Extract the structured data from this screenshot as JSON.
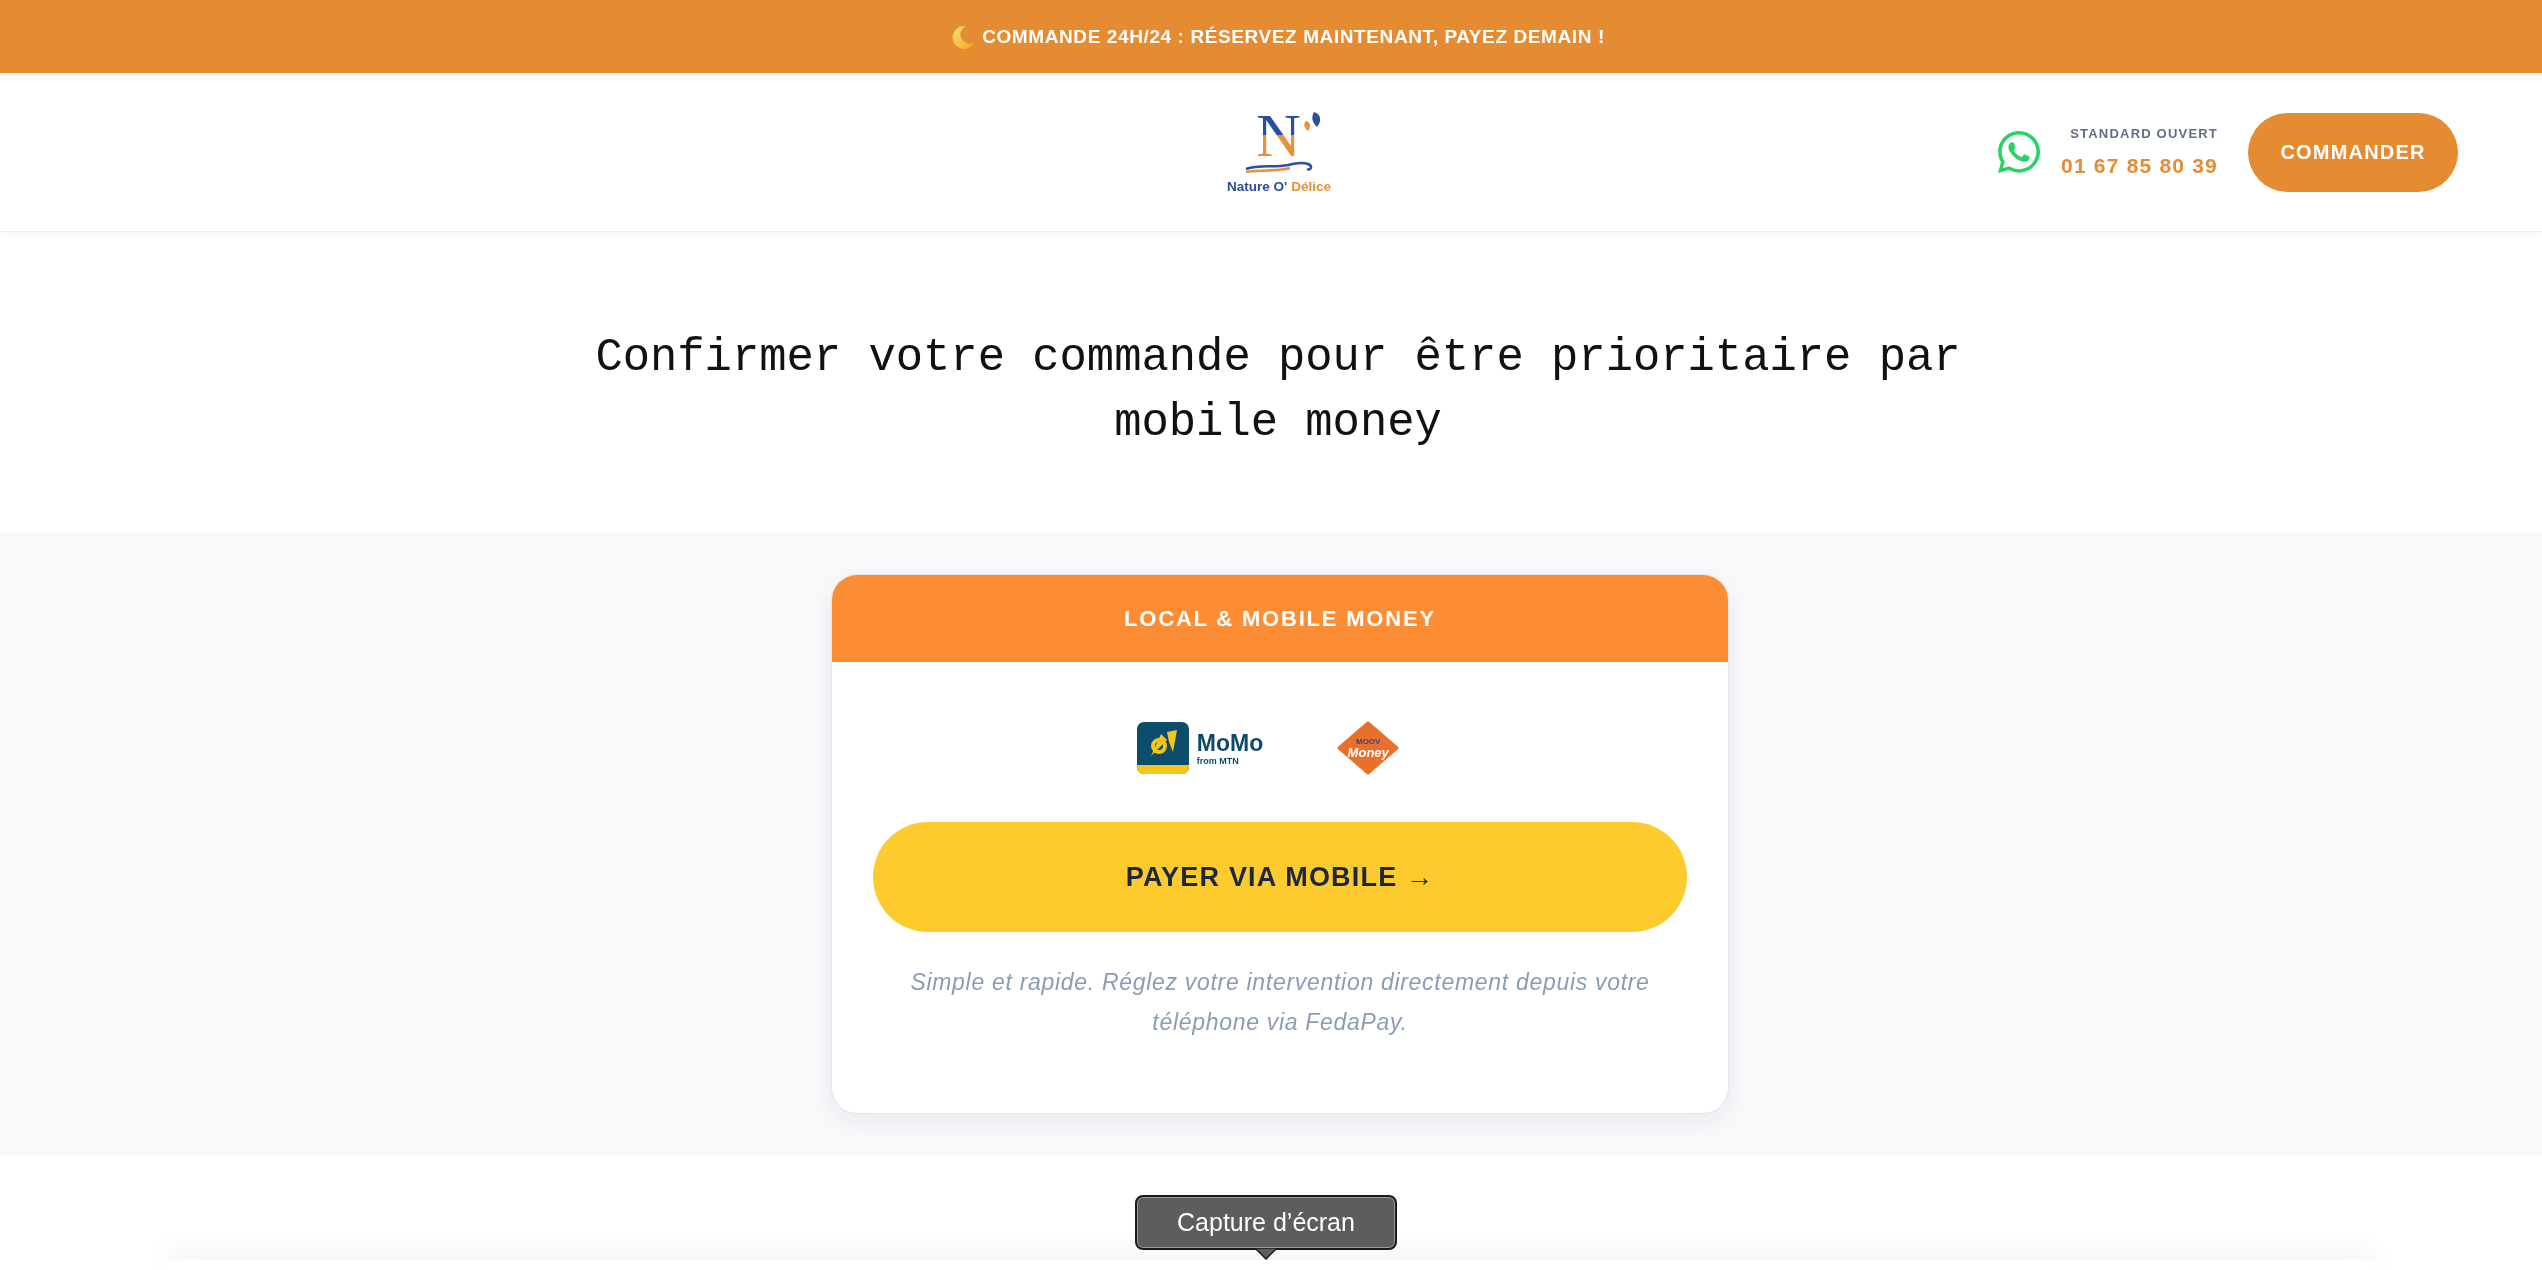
{
  "announcement_bar": {
    "text": "COMMANDE 24H/24 : RÉSERVEZ MAINTENANT, PAYEZ DEMAIN !"
  },
  "header": {
    "logo": {
      "monogram": "N",
      "wordmark": [
        {
          "text": "Nature O'",
          "color": "#2b4c9b"
        },
        {
          "text": "Délice",
          "color": "#e8913a"
        }
      ]
    },
    "contact": {
      "label": "STANDARD OUVERT",
      "phone": "01 67 85 80 39"
    },
    "cta_button": "COMMANDER"
  },
  "hero": {
    "heading": "Confirmer votre commande pour être prioritaire par mobile money"
  },
  "payment_card": {
    "title": "LOCAL & MOBILE MONEY",
    "providers": [
      {
        "kind": "tile",
        "name": "MoMo",
        "tagline": "from MTN"
      },
      {
        "kind": "diamond",
        "name": "Money",
        "tagline": "MOOV"
      }
    ],
    "button": "PAYER VIA MOBILE →",
    "note": "Simple et rapide. Réglez votre intervention directement depuis votre téléphone via FedaPay."
  },
  "tooltip": {
    "text": "Capture d’écran"
  }
}
